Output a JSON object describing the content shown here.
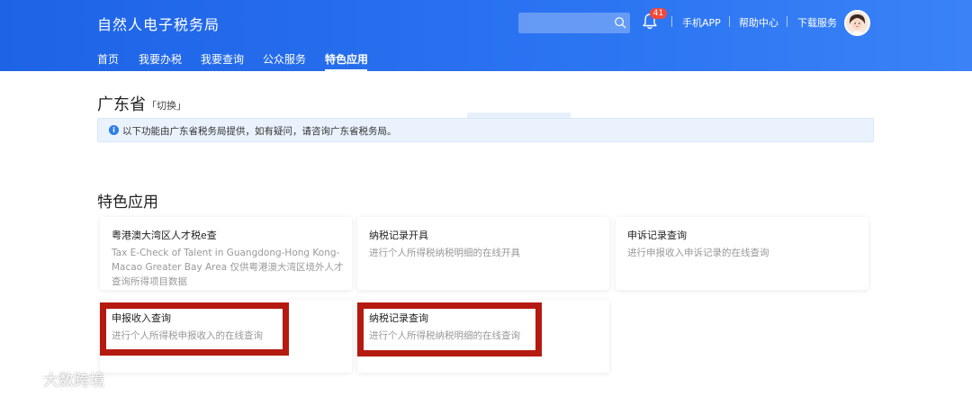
{
  "header": {
    "brand": "自然人电子税务局",
    "search": {
      "value": "",
      "placeholder": ""
    },
    "notification_count": "41",
    "links": [
      "手机APP",
      "帮助中心",
      "下载服务"
    ]
  },
  "nav": {
    "tabs": [
      {
        "label": "首页"
      },
      {
        "label": "我要办税"
      },
      {
        "label": "我要查询"
      },
      {
        "label": "公众服务"
      },
      {
        "label": "特色应用"
      }
    ],
    "active": "特色应用"
  },
  "province": {
    "name": "广东省",
    "switch_label": "「切换」"
  },
  "notice": {
    "text": "以下功能由广东省税务局提供，如有疑问，请咨询广东省税务局。"
  },
  "section": {
    "title": "特色应用"
  },
  "cards": [
    {
      "title": "粤港澳大湾区人才税e查",
      "desc": "Tax E-Check of Talent in Guangdong-Hong Kong-Macao Greater Bay Area 仅供粤港澳大湾区境外人才查询所得项目数据"
    },
    {
      "title": "纳税记录开具",
      "desc": "进行个人所得税纳税明细的在线开具"
    },
    {
      "title": "申诉记录查询",
      "desc": "进行申报收入申诉记录的在线查询"
    },
    {
      "title": "申报收入查询",
      "desc": "进行个人所得税申报收入的在线查询"
    },
    {
      "title": "纳税记录查询",
      "desc": "进行个人所得税纳税明细的在线查询"
    }
  ],
  "watermark": {
    "text": "大数跨境"
  },
  "colors": {
    "header": "#1e63e6",
    "highlight": "#b51a10",
    "notice_bg": "#eaf3fd",
    "badge": "#f5483b"
  }
}
